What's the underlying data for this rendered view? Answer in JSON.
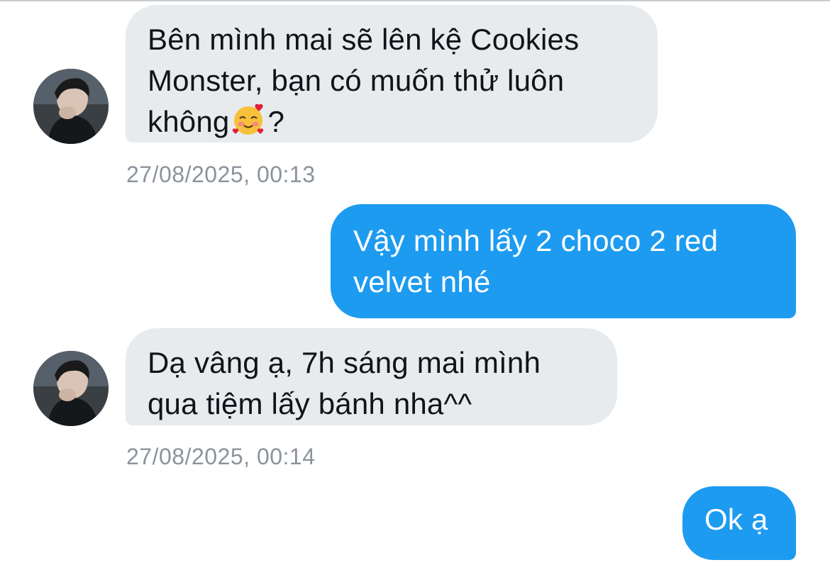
{
  "conversation": {
    "messages": [
      {
        "direction": "incoming",
        "lines": [
          "Bên mình mai sẽ lên kệ Cookies",
          "Monster, bạn có muốn thử luôn",
          "không",
          "?"
        ],
        "emoji": "smiling-face-with-hearts",
        "timestamp": "27/08/2025, 00:13"
      },
      {
        "direction": "outgoing",
        "lines": [
          "Vậy mình lấy 2 choco 2 red",
          "velvet nhé"
        ]
      },
      {
        "direction": "incoming",
        "lines": [
          "Dạ vâng ạ, 7h sáng mai mình",
          "qua tiệm lấy bánh nha^^"
        ],
        "timestamp": "27/08/2025, 00:14"
      },
      {
        "direction": "outgoing",
        "lines": [
          "Ok ạ"
        ]
      }
    ]
  },
  "colors": {
    "incoming_bubble": "#e7ebee",
    "outgoing_bubble": "#1d9bf0",
    "timestamp_text": "#8b939b"
  }
}
